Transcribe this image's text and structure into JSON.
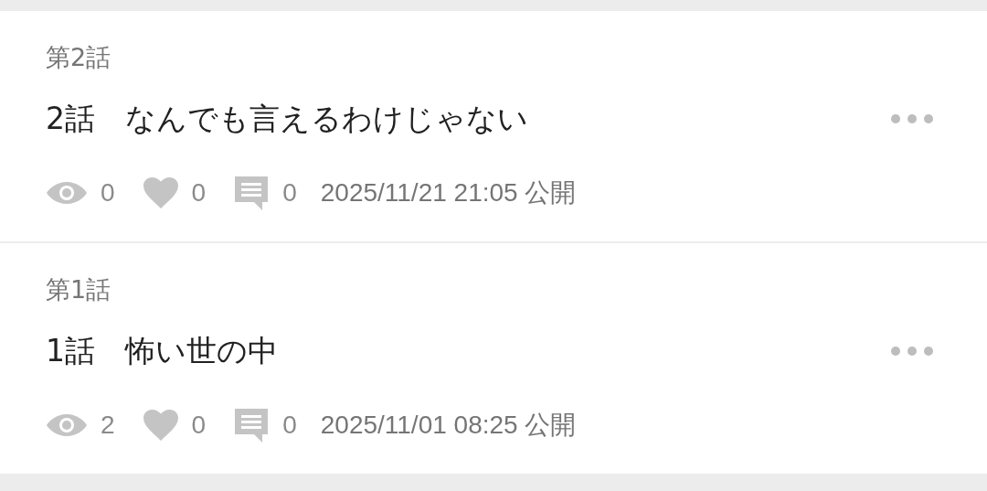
{
  "episodes": [
    {
      "number": "第2話",
      "title": "2話　なんでも言えるわけじゃない",
      "views": "0",
      "likes": "0",
      "comments": "0",
      "published": "2025/11/21 21:05 公開"
    },
    {
      "number": "第1話",
      "title": "1話　怖い世の中",
      "views": "2",
      "likes": "0",
      "comments": "0",
      "published": "2025/11/01 08:25 公開"
    }
  ]
}
